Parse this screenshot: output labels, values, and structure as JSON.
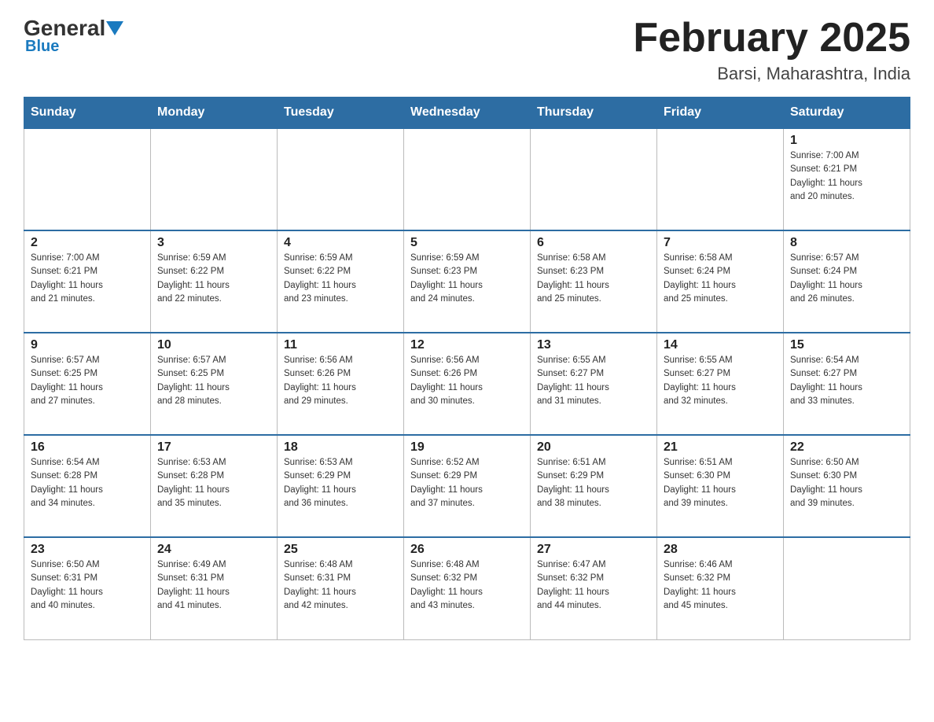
{
  "header": {
    "logo_general": "General",
    "logo_blue": "Blue",
    "title": "February 2025",
    "subtitle": "Barsi, Maharashtra, India"
  },
  "days_of_week": [
    "Sunday",
    "Monday",
    "Tuesday",
    "Wednesday",
    "Thursday",
    "Friday",
    "Saturday"
  ],
  "weeks": [
    [
      {
        "day": "",
        "info": ""
      },
      {
        "day": "",
        "info": ""
      },
      {
        "day": "",
        "info": ""
      },
      {
        "day": "",
        "info": ""
      },
      {
        "day": "",
        "info": ""
      },
      {
        "day": "",
        "info": ""
      },
      {
        "day": "1",
        "info": "Sunrise: 7:00 AM\nSunset: 6:21 PM\nDaylight: 11 hours\nand 20 minutes."
      }
    ],
    [
      {
        "day": "2",
        "info": "Sunrise: 7:00 AM\nSunset: 6:21 PM\nDaylight: 11 hours\nand 21 minutes."
      },
      {
        "day": "3",
        "info": "Sunrise: 6:59 AM\nSunset: 6:22 PM\nDaylight: 11 hours\nand 22 minutes."
      },
      {
        "day": "4",
        "info": "Sunrise: 6:59 AM\nSunset: 6:22 PM\nDaylight: 11 hours\nand 23 minutes."
      },
      {
        "day": "5",
        "info": "Sunrise: 6:59 AM\nSunset: 6:23 PM\nDaylight: 11 hours\nand 24 minutes."
      },
      {
        "day": "6",
        "info": "Sunrise: 6:58 AM\nSunset: 6:23 PM\nDaylight: 11 hours\nand 25 minutes."
      },
      {
        "day": "7",
        "info": "Sunrise: 6:58 AM\nSunset: 6:24 PM\nDaylight: 11 hours\nand 25 minutes."
      },
      {
        "day": "8",
        "info": "Sunrise: 6:57 AM\nSunset: 6:24 PM\nDaylight: 11 hours\nand 26 minutes."
      }
    ],
    [
      {
        "day": "9",
        "info": "Sunrise: 6:57 AM\nSunset: 6:25 PM\nDaylight: 11 hours\nand 27 minutes."
      },
      {
        "day": "10",
        "info": "Sunrise: 6:57 AM\nSunset: 6:25 PM\nDaylight: 11 hours\nand 28 minutes."
      },
      {
        "day": "11",
        "info": "Sunrise: 6:56 AM\nSunset: 6:26 PM\nDaylight: 11 hours\nand 29 minutes."
      },
      {
        "day": "12",
        "info": "Sunrise: 6:56 AM\nSunset: 6:26 PM\nDaylight: 11 hours\nand 30 minutes."
      },
      {
        "day": "13",
        "info": "Sunrise: 6:55 AM\nSunset: 6:27 PM\nDaylight: 11 hours\nand 31 minutes."
      },
      {
        "day": "14",
        "info": "Sunrise: 6:55 AM\nSunset: 6:27 PM\nDaylight: 11 hours\nand 32 minutes."
      },
      {
        "day": "15",
        "info": "Sunrise: 6:54 AM\nSunset: 6:27 PM\nDaylight: 11 hours\nand 33 minutes."
      }
    ],
    [
      {
        "day": "16",
        "info": "Sunrise: 6:54 AM\nSunset: 6:28 PM\nDaylight: 11 hours\nand 34 minutes."
      },
      {
        "day": "17",
        "info": "Sunrise: 6:53 AM\nSunset: 6:28 PM\nDaylight: 11 hours\nand 35 minutes."
      },
      {
        "day": "18",
        "info": "Sunrise: 6:53 AM\nSunset: 6:29 PM\nDaylight: 11 hours\nand 36 minutes."
      },
      {
        "day": "19",
        "info": "Sunrise: 6:52 AM\nSunset: 6:29 PM\nDaylight: 11 hours\nand 37 minutes."
      },
      {
        "day": "20",
        "info": "Sunrise: 6:51 AM\nSunset: 6:29 PM\nDaylight: 11 hours\nand 38 minutes."
      },
      {
        "day": "21",
        "info": "Sunrise: 6:51 AM\nSunset: 6:30 PM\nDaylight: 11 hours\nand 39 minutes."
      },
      {
        "day": "22",
        "info": "Sunrise: 6:50 AM\nSunset: 6:30 PM\nDaylight: 11 hours\nand 39 minutes."
      }
    ],
    [
      {
        "day": "23",
        "info": "Sunrise: 6:50 AM\nSunset: 6:31 PM\nDaylight: 11 hours\nand 40 minutes."
      },
      {
        "day": "24",
        "info": "Sunrise: 6:49 AM\nSunset: 6:31 PM\nDaylight: 11 hours\nand 41 minutes."
      },
      {
        "day": "25",
        "info": "Sunrise: 6:48 AM\nSunset: 6:31 PM\nDaylight: 11 hours\nand 42 minutes."
      },
      {
        "day": "26",
        "info": "Sunrise: 6:48 AM\nSunset: 6:32 PM\nDaylight: 11 hours\nand 43 minutes."
      },
      {
        "day": "27",
        "info": "Sunrise: 6:47 AM\nSunset: 6:32 PM\nDaylight: 11 hours\nand 44 minutes."
      },
      {
        "day": "28",
        "info": "Sunrise: 6:46 AM\nSunset: 6:32 PM\nDaylight: 11 hours\nand 45 minutes."
      },
      {
        "day": "",
        "info": ""
      }
    ]
  ]
}
